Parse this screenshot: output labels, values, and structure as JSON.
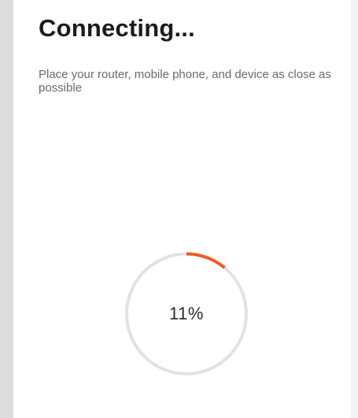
{
  "header": {
    "title": "Connecting..."
  },
  "instructions": {
    "text": "Place your router, mobile phone, and device as close as possible"
  },
  "progress": {
    "value": 11,
    "label": "11%"
  },
  "colors": {
    "accent": "#f05a28",
    "track": "#e2e2e2",
    "background": "#ffffff",
    "side_gutter": "#dcdcdc"
  }
}
